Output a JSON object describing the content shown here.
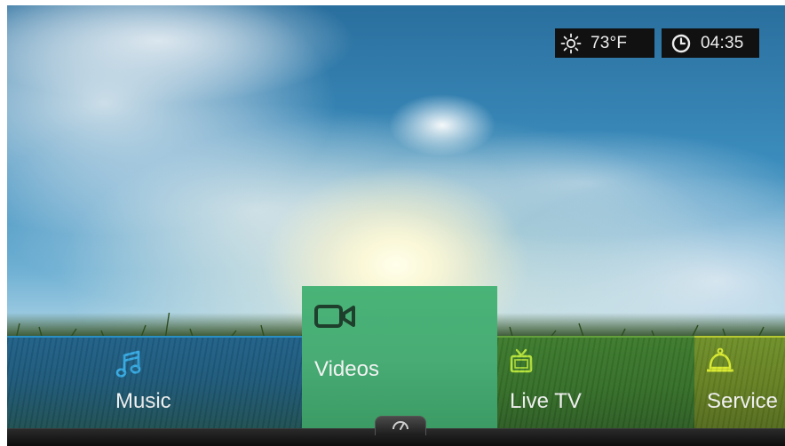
{
  "status": {
    "weather": {
      "icon": "sun-icon",
      "temperature": "73°F"
    },
    "clock": {
      "icon": "clock-icon",
      "time": "04:35"
    }
  },
  "menu": {
    "items": [
      {
        "label": "Music",
        "icon": "music-note-icon",
        "color": "#35a8e0",
        "selected": false
      },
      {
        "label": "Videos",
        "icon": "video-camera-icon",
        "color": "#1f3f2d",
        "selected": true
      },
      {
        "label": "Live TV",
        "icon": "tv-icon",
        "color": "#b6e33a",
        "selected": false
      },
      {
        "label": "Service",
        "icon": "service-bell-icon",
        "color": "#d9ea2f",
        "selected": false
      }
    ]
  },
  "dock": {
    "icon": "speedometer-icon"
  }
}
